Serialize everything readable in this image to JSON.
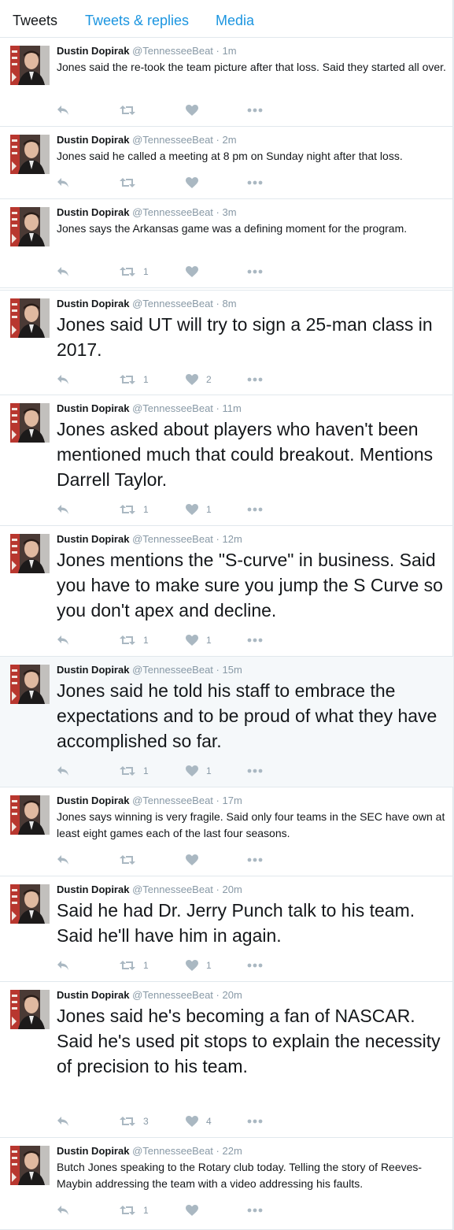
{
  "tabs": [
    "Tweets",
    "Tweets & replies",
    "Media"
  ],
  "user": {
    "name": "Dustin Dopirak",
    "handle": "@TennesseeBeat"
  },
  "colors": {
    "accent": "#1b95e0",
    "muted": "#8899a6",
    "icon": "#aab8c2",
    "text": "#14171a"
  },
  "tweets": [
    {
      "time": "1m",
      "text": "Jones said the re-took the team picture after that loss. Said they started all over.",
      "retweets": "",
      "likes": ""
    },
    {
      "time": "2m",
      "text": "Jones said he called a meeting at 8 pm on Sunday night after that loss.",
      "retweets": "",
      "likes": ""
    },
    {
      "time": "3m",
      "text": "Jones says the Arkansas game was a defining moment for the program.",
      "retweets": "1",
      "likes": ""
    },
    {
      "time": "8m",
      "text": "Jones said UT will try to sign a 25-man class in 2017.",
      "retweets": "1",
      "likes": "2"
    },
    {
      "time": "11m",
      "text": "Jones asked about players who haven't been mentioned much that could breakout. Mentions Darrell Taylor.",
      "retweets": "1",
      "likes": "1"
    },
    {
      "time": "12m",
      "text": "Jones mentions the \"S-curve\" in business. Said you have to make sure you jump the S Curve so you don't apex and decline.",
      "retweets": "1",
      "likes": "1"
    },
    {
      "time": "15m",
      "text": "Jones said he told his staff to embrace the expectations and to be proud of what they have accomplished so far.",
      "retweets": "1",
      "likes": "1"
    },
    {
      "time": "17m",
      "text": "Jones says winning is very fragile. Said only four teams in the SEC have own at least eight games each of the last four seasons.",
      "retweets": "",
      "likes": ""
    },
    {
      "time": "20m",
      "text": "Said he had Dr. Jerry Punch talk to his team. Said he'll have him in again.",
      "retweets": "1",
      "likes": "1"
    },
    {
      "time": "20m",
      "text": "Jones said he's becoming a fan of NASCAR. Said he's used pit stops to explain the necessity of precision to his team.",
      "retweets": "3",
      "likes": "4"
    },
    {
      "time": "22m",
      "text": "Butch Jones speaking to the Rotary club today. Telling the story of Reeves-Maybin addressing the team with a video addressing his faults.",
      "retweets": "1",
      "likes": ""
    }
  ]
}
